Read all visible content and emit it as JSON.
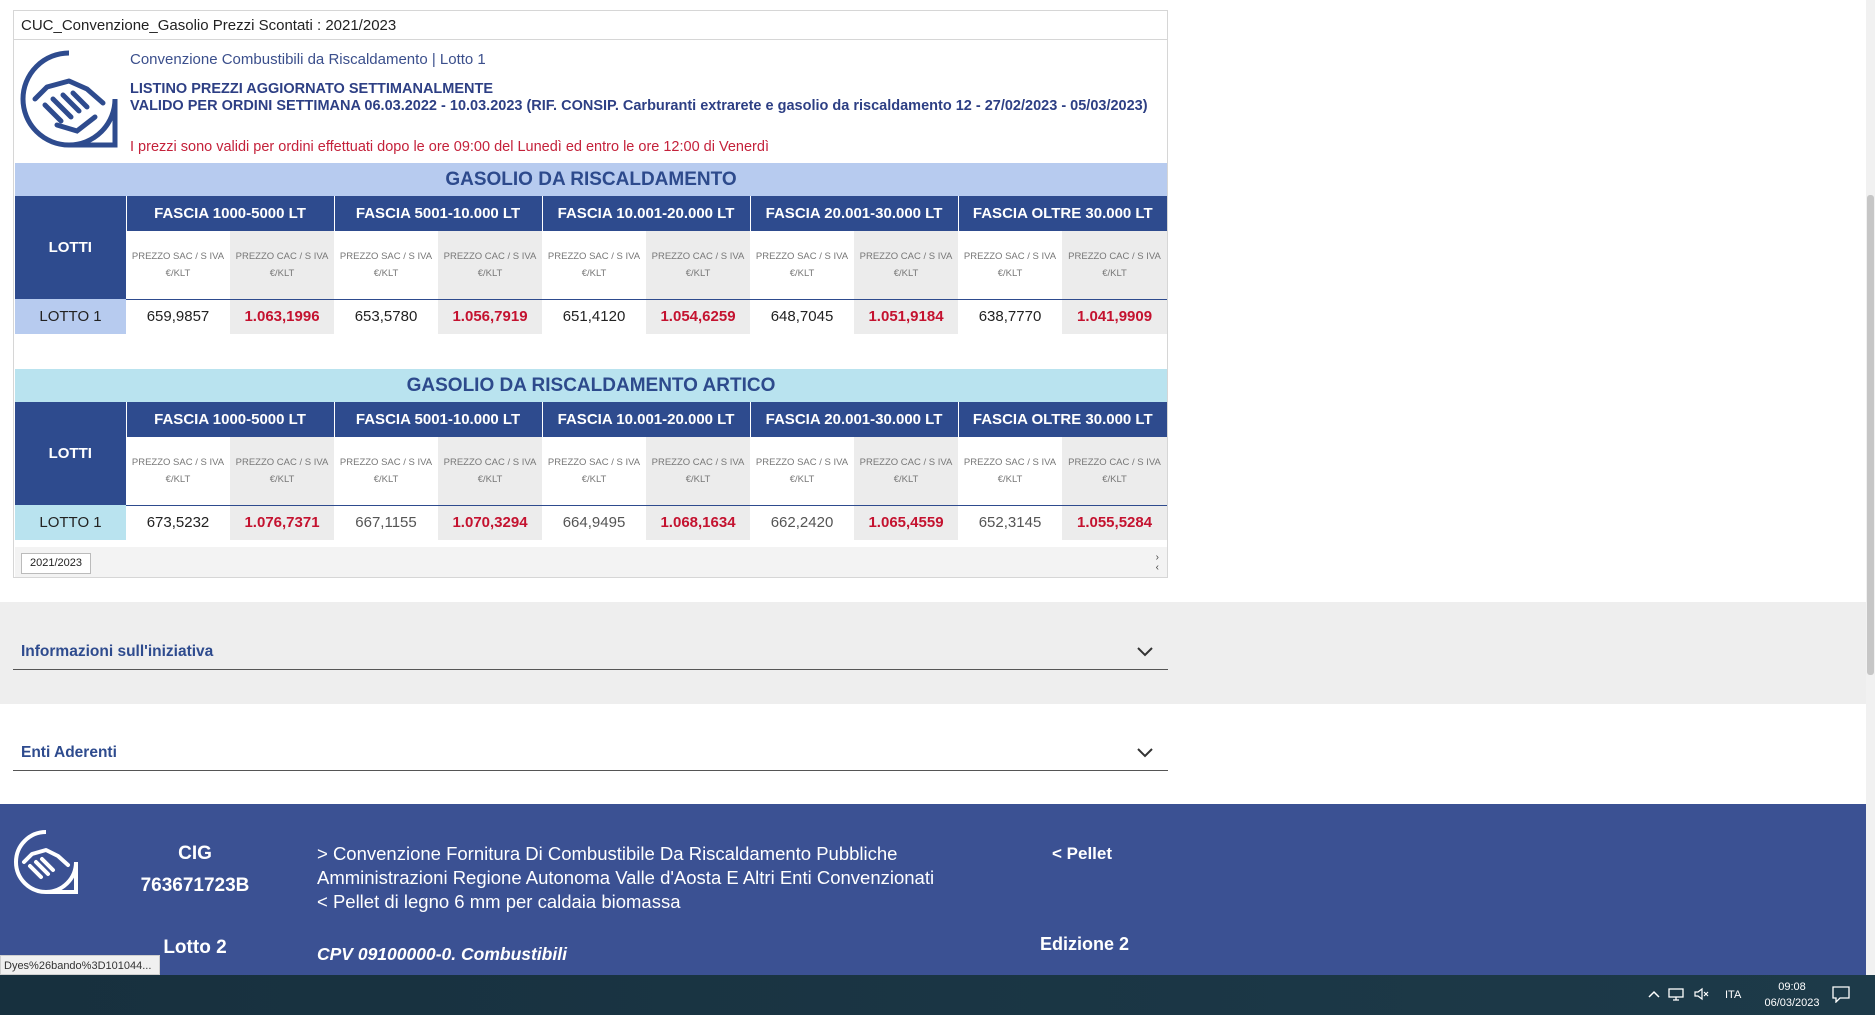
{
  "report": {
    "title": "CUC_Convenzione_Gasolio Prezzi Scontati : 2021/2023",
    "subtitle": "Convenzione Combustibili da Riscaldamento | Lotto 1",
    "heading1": "LISTINO PREZZI AGGIORNATO SETTIMANALMENTE",
    "heading2": "VALIDO PER ORDINI SETTIMANA 06.03.2022 - 10.03.2023 (RIF. CONSIP. Carburanti extrarete e gasolio da riscaldamento 12 - 27/02/2023 - 05/03/2023)",
    "note": "I prezzi sono validi per ordini effettuati dopo le ore 09:00 del Lunedì ed entro le ore 12:00 di Venerdì",
    "tab_label": "2021/2023",
    "scroll_right": "›",
    "scroll_left": "‹"
  },
  "table_common": {
    "lotti_label": "LOTTI",
    "fasce": [
      "FASCIA 1000-5000 LT",
      "FASCIA 5001-10.000 LT",
      "FASCIA 10.001-20.000 LT",
      "FASCIA 20.001-30.000 LT",
      "FASCIA OLTRE 30.000 LT"
    ],
    "sac_label": "PREZZO SAC / S IVA",
    "cac_label": "PREZZO CAC / S IVA",
    "unit": "€/KLT"
  },
  "sections": [
    {
      "title": "GASOLIO DA RISCALDAMENTO",
      "row_label": "LOTTO 1",
      "values": [
        "659,9857",
        "1.063,1996",
        "653,5780",
        "1.056,7919",
        "651,4120",
        "1.054,6259",
        "648,7045",
        "1.051,9184",
        "638,7770",
        "1.041,9909"
      ]
    },
    {
      "title": "GASOLIO DA RISCALDAMENTO ARTICO",
      "row_label": "LOTTO 1",
      "values": [
        "673,5232",
        "1.076,7371",
        "667,1155",
        "1.070,3294",
        "664,9495",
        "1.068,1634",
        "662,2420",
        "1.065,4559",
        "652,3145",
        "1.055,5284"
      ]
    }
  ],
  "accordions": {
    "info": "Informazioni sull'iniziativa",
    "enti": "Enti Aderenti"
  },
  "footer": {
    "cig_label": "CIG",
    "cig_value": "763671723B",
    "lotto": "Lotto 2",
    "conv_line1": "> Convenzione Fornitura Di Combustibile Da Riscaldamento Pubbliche",
    "conv_line2": "Amministrazioni Regione Autonoma Valle d'Aosta E Altri Enti Convenzionati",
    "conv_line3": "< Pellet di legno 6 mm per caldaia biomassa",
    "cpv": "CPV  09100000-0. Combustibili",
    "pellet": "< Pellet",
    "edizione": "Edizione 2"
  },
  "status_url": "Dyes%26bando%3D101044...",
  "taskbar": {
    "lang": "ITA",
    "time": "09:08",
    "date": "06/03/2023"
  },
  "colors": {
    "header_blue": "#2e4b8e",
    "section_blue": "#b7cbef",
    "section_cyan": "#b9e3ef",
    "price_red": "#c4122f",
    "footer_blue": "#3b5193"
  }
}
